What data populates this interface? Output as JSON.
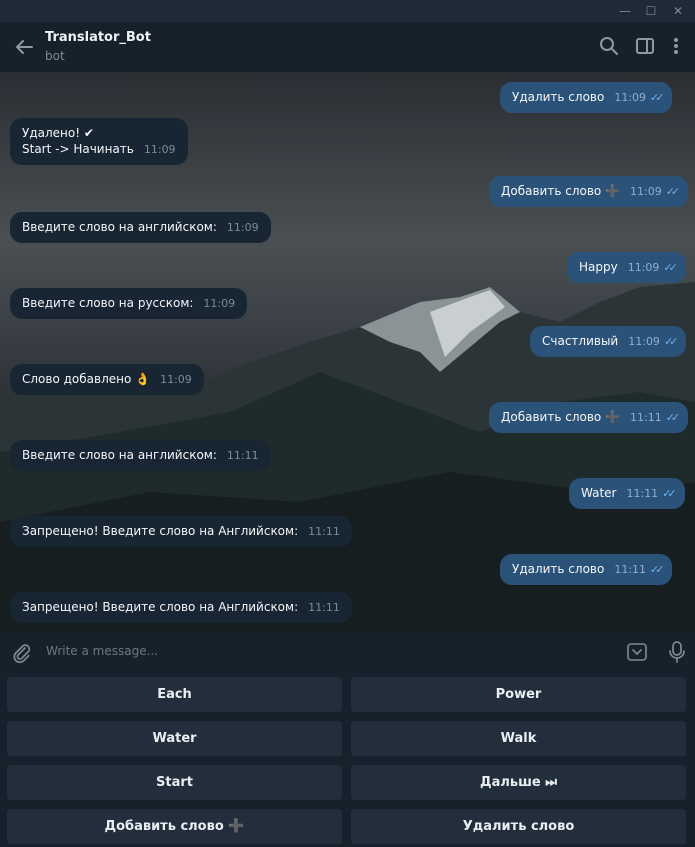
{
  "header": {
    "title": "Translator_Bot",
    "subtitle": "bot"
  },
  "messages": [
    {
      "text": "Удалить слово",
      "time": "11:09",
      "dir": "out"
    },
    {
      "line1": "Удалено! ✔",
      "line2": "Start -> Начинать",
      "time": "11:09",
      "dir": "in"
    },
    {
      "text": "Добавить слово ➕",
      "time": "11:09",
      "dir": "out"
    },
    {
      "text": "Введите слово на английском:",
      "time": "11:09",
      "dir": "in"
    },
    {
      "text": "Happy",
      "time": "11:09",
      "dir": "out"
    },
    {
      "text": "Введите слово на русском:",
      "time": "11:09",
      "dir": "in"
    },
    {
      "text": "Счастливый",
      "time": "11:09",
      "dir": "out"
    },
    {
      "text": "Слово добавлено 👌",
      "time": "11:09",
      "dir": "in"
    },
    {
      "text": "Добавить слово ➕",
      "time": "11:11",
      "dir": "out"
    },
    {
      "text": "Введите слово на английском:",
      "time": "11:11",
      "dir": "in"
    },
    {
      "text": "Water",
      "time": "11:11",
      "dir": "out"
    },
    {
      "text": "Запрещено! Введите слово на Английском:",
      "time": "11:11",
      "dir": "in"
    },
    {
      "text": "Удалить слово",
      "time": "11:11",
      "dir": "out"
    },
    {
      "text": "Запрещено! Введите слово на Английском:",
      "time": "11:11",
      "dir": "in"
    }
  ],
  "input": {
    "placeholder": "Write a message..."
  },
  "keyboard": {
    "each": "Each",
    "power": "Power",
    "water": "Water",
    "walk": "Walk",
    "start": "Start",
    "next": "Дальше ⏭",
    "add": "Добавить слово ➕",
    "delete": "Удалить слово"
  }
}
